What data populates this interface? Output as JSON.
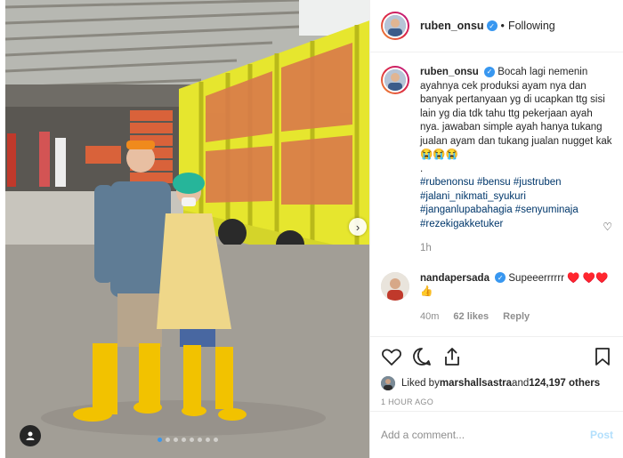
{
  "post": {
    "image_alt": "",
    "carousel": {
      "total": 8,
      "active": 1
    }
  },
  "header": {
    "username": "ruben_onsu",
    "separator": "•",
    "follow_state": "Following"
  },
  "caption": {
    "username": "ruben_onsu",
    "text": "Bocah lagi nemenin ayahnya cek produksi ayam nya dan banyak pertanyaan yg di ucapkan ttg sisi lain yg dia tdk tahu ttg pekerjaan ayah nya. jawaban simple ayah hanya tukang jualan ayam dan tukang jualan nugget kak 😭😭😭",
    "dot": ".",
    "hashtags": "#rubenonsu #bensu #justruben #jalani_nikmati_syukuri #janganlupabahagia #senyuminaja #rezekigakketuker",
    "time": "1h"
  },
  "comment": {
    "username": "nandapersada",
    "text": "Supeeerrrrrr ♥️ ♥️♥️👍",
    "time": "40m",
    "likes": "62 likes",
    "reply": "Reply"
  },
  "likes": {
    "prefix": "Liked by ",
    "user": "marshallsastra",
    "and": " and ",
    "count": "124,197 others"
  },
  "timestamp": "1 HOUR AGO",
  "add_comment": {
    "placeholder": "Add a comment...",
    "post_label": "Post"
  },
  "colors": {
    "accent": "#3897f0",
    "hashtag": "#00376b",
    "muted": "#8e8e8e",
    "post_disabled": "#b2dffc"
  }
}
